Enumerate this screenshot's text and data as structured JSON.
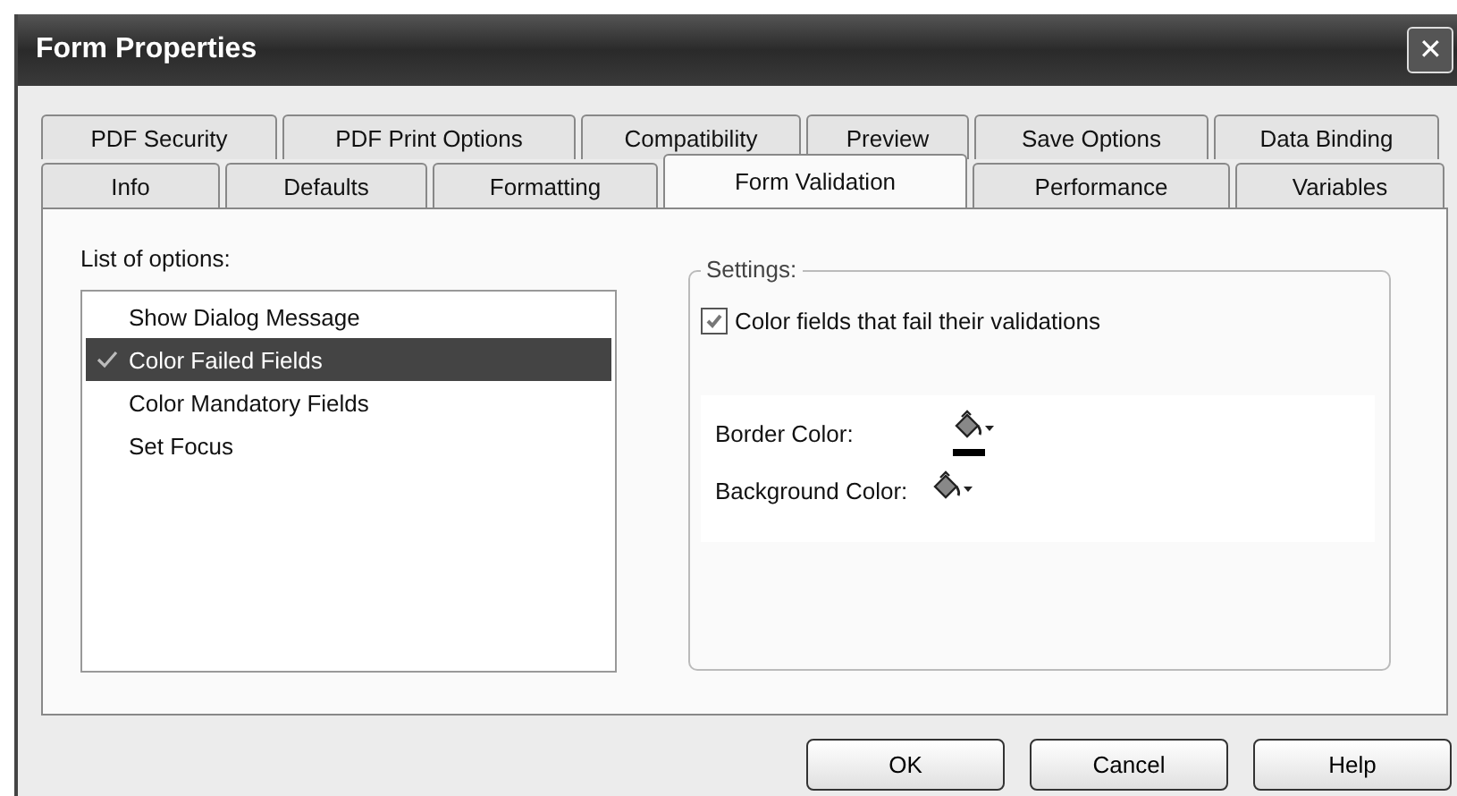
{
  "window": {
    "title": "Form Properties",
    "close": "✕"
  },
  "tab_rows": [
    [
      {
        "label": "PDF Security",
        "selected": false
      },
      {
        "label": "PDF Print Options",
        "selected": false
      },
      {
        "label": "Compatibility",
        "selected": false
      },
      {
        "label": "Preview",
        "selected": false
      },
      {
        "label": "Save Options",
        "selected": false
      },
      {
        "label": "Data Binding",
        "selected": false
      }
    ],
    [
      {
        "label": "Info",
        "selected": false
      },
      {
        "label": "Defaults",
        "selected": false
      },
      {
        "label": "Formatting",
        "selected": false
      },
      {
        "label": "Form Validation",
        "selected": true
      },
      {
        "label": "Performance",
        "selected": false
      },
      {
        "label": "Variables",
        "selected": false
      }
    ]
  ],
  "options": {
    "label": "List of options:",
    "items": [
      {
        "label": "Show Dialog Message",
        "selected": false,
        "checked": false
      },
      {
        "label": "Color Failed Fields",
        "selected": true,
        "checked": true
      },
      {
        "label": "Color Mandatory Fields",
        "selected": false,
        "checked": false
      },
      {
        "label": "Set Focus",
        "selected": false,
        "checked": false
      }
    ]
  },
  "settings": {
    "title": "Settings:",
    "checkbox": {
      "label": "Color fields that fail their validations",
      "checked": true
    },
    "colors": [
      {
        "label": "Border Color:",
        "color": "#000000"
      },
      {
        "label": "Background Color:"
      }
    ]
  },
  "buttons": [
    "OK",
    "Cancel",
    "Help"
  ]
}
